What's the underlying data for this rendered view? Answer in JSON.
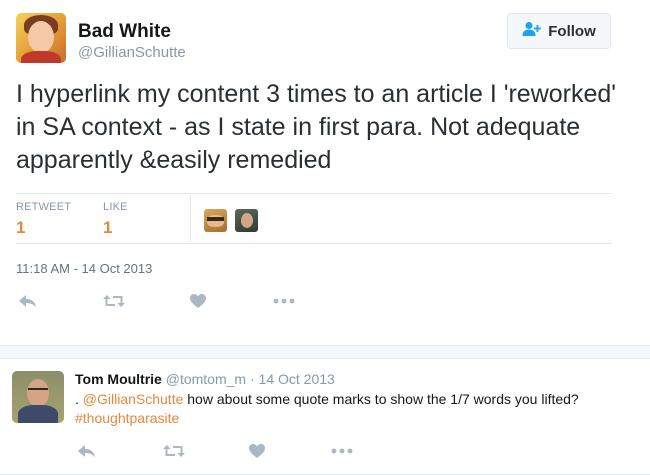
{
  "tweet": {
    "author_name": "Bad White",
    "author_handle": "@GillianSchutte",
    "follow_label": "Follow",
    "text": "I hyperlink my content 3 times to an article I 'reworked' in SA context - as I state in first para. Not adequate apparently &easily remedied",
    "stats": {
      "retweet_label": "RETWEET",
      "retweet_count": "1",
      "like_label": "LIKE",
      "like_count": "1"
    },
    "timestamp": "11:18 AM - 14 Oct 2013",
    "actions": [
      "reply-icon",
      "retweet-icon",
      "like-icon",
      "more-icon"
    ]
  },
  "reply": {
    "author_name": "Tom Moultrie",
    "author_handle": "@tomtom_m",
    "separator": "·",
    "date": "14 Oct 2013",
    "text_prefix": ". ",
    "mention": "@GillianSchutte",
    "text_middle": " how about some quote marks to show the 1/7 words you lifted? ",
    "hashtag": "#thoughtparasite",
    "actions": [
      "reply-icon",
      "retweet-icon",
      "like-icon",
      "more-icon"
    ]
  },
  "colors": {
    "accent": "#e5883e",
    "icon": "#aab8c2",
    "muted": "#8899a6",
    "follow_icon": "#1da1f2"
  }
}
